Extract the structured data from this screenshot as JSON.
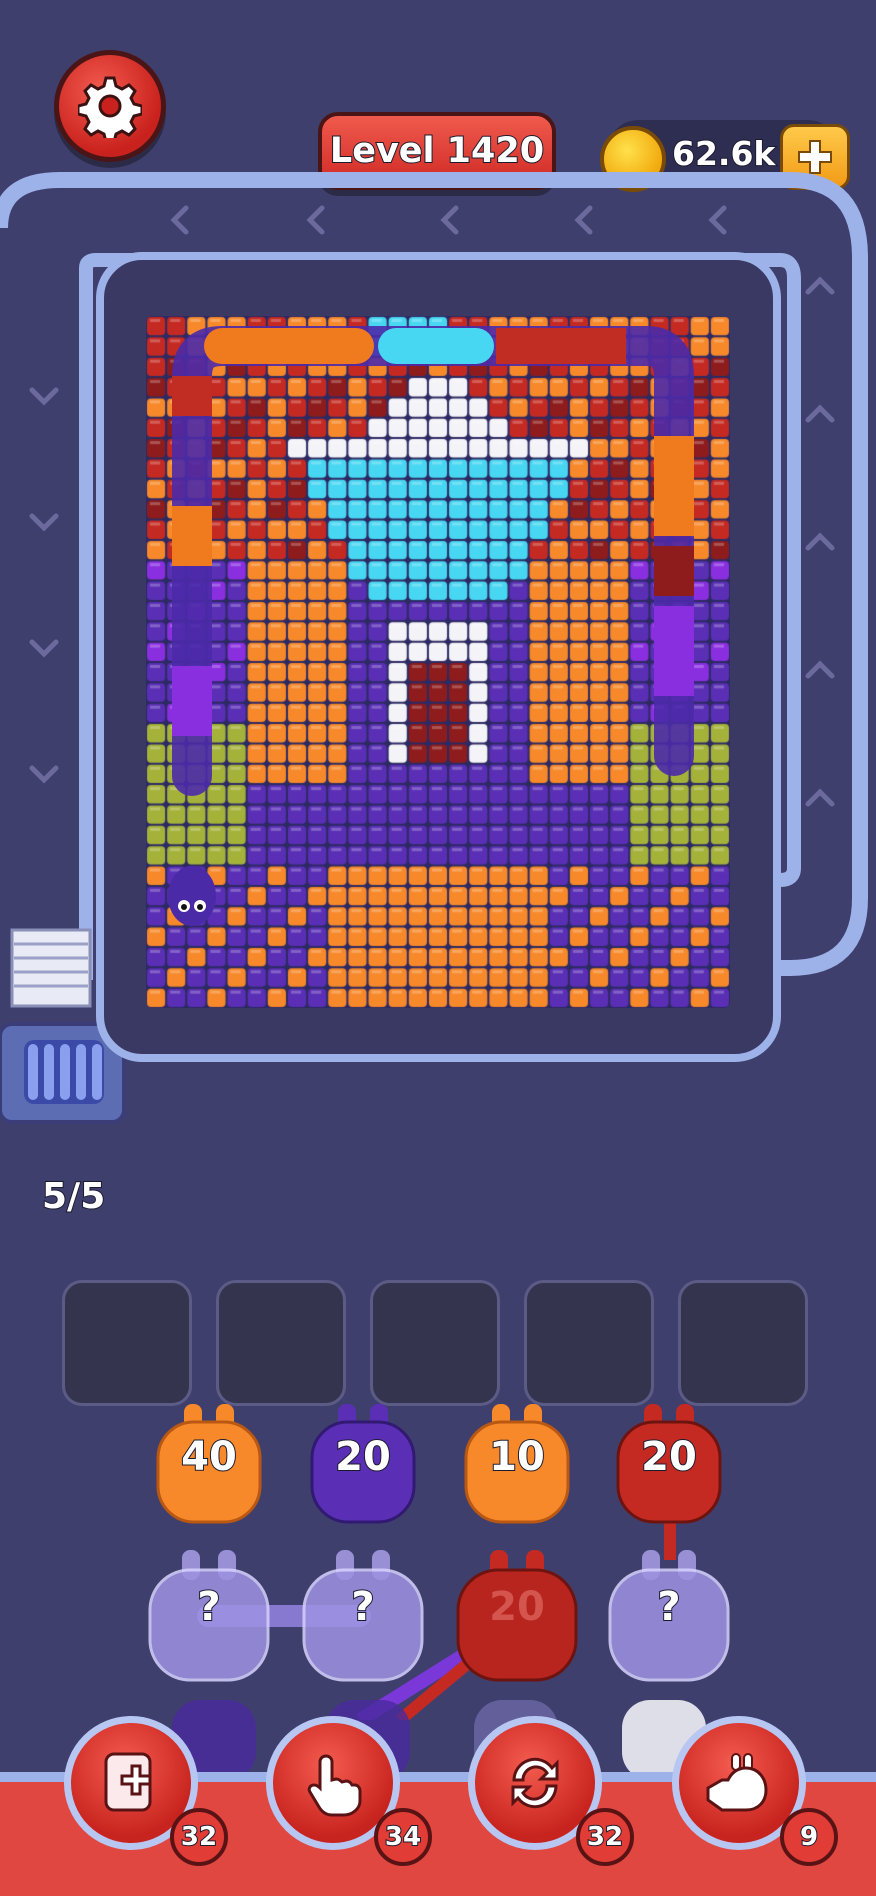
{
  "header": {
    "level_label": "Level 1420",
    "coins": "62.6k"
  },
  "settings": {
    "icon": "gear-icon"
  },
  "coin_add": {
    "icon": "plus-icon"
  },
  "queue_counter": "5/5",
  "colors": {
    "bg": "#3f3f6e",
    "track": "#9eb2ea",
    "red": "#c42a22",
    "orange": "#f7892a",
    "purple": "#5a2fb5",
    "violet": "#8a2fe0",
    "cyan": "#48d7f2",
    "white": "#f4f4f8",
    "olive": "#a4b23a",
    "darkred": "#8e1c1c"
  },
  "slots": [
    "",
    "",
    "",
    "",
    ""
  ],
  "creatures_top": [
    {
      "count": "40",
      "color": "orange"
    },
    {
      "count": "20",
      "color": "purple"
    },
    {
      "count": "10",
      "color": "orange"
    },
    {
      "count": "20",
      "color": "red"
    }
  ],
  "creatures_mid": [
    {
      "count": "?",
      "color": "hidden"
    },
    {
      "count": "?",
      "color": "hidden"
    },
    {
      "count": "20",
      "color": "red"
    },
    {
      "count": "?",
      "color": "hidden"
    }
  ],
  "powerups": [
    {
      "name": "add-slot",
      "icon": "card-plus-icon",
      "count": "32"
    },
    {
      "name": "pick",
      "icon": "pointing-hand-icon",
      "count": "34"
    },
    {
      "name": "shuffle",
      "icon": "refresh-icon",
      "count": "32"
    },
    {
      "name": "train",
      "icon": "rocket-creature-icon",
      "count": "9"
    }
  ]
}
